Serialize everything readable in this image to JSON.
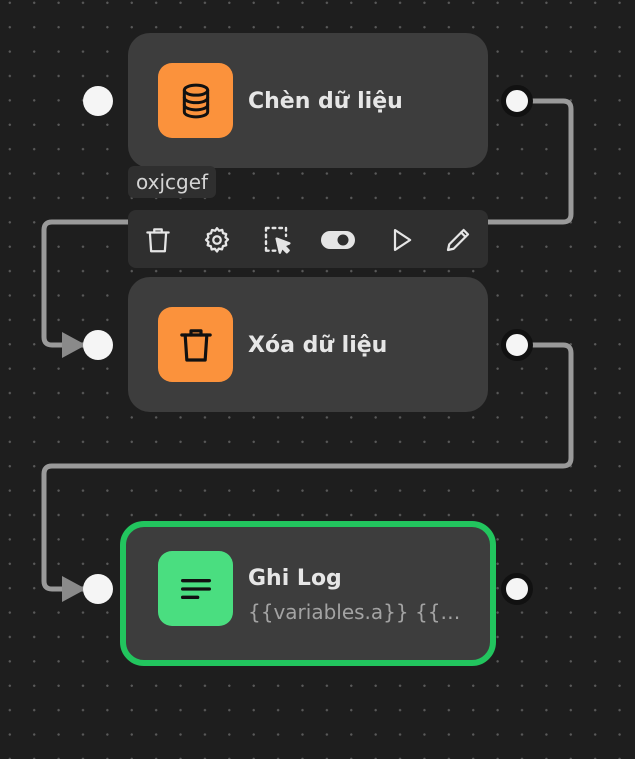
{
  "canvas": {
    "accent_color": "#22c55e",
    "background_color": "#1e1e1e"
  },
  "nodes": [
    {
      "id": "n1",
      "title": "Chèn dữ liệu",
      "icon": "database-icon",
      "icon_color": "#fb923c"
    },
    {
      "id": "n2",
      "title": "Xóa dữ liệu",
      "icon": "trash-icon",
      "icon_color": "#fb923c"
    },
    {
      "id": "n3",
      "title": "Ghi Log",
      "subtitle": "{{variables.a}} {{t…",
      "icon": "text-lines-icon",
      "icon_color": "#4ade80",
      "selected": true
    }
  ],
  "selection": {
    "node_id_label": "oxjcgef"
  },
  "toolbar": {
    "tools": [
      {
        "name": "delete",
        "icon": "trash-icon"
      },
      {
        "name": "settings",
        "icon": "gear-icon"
      },
      {
        "name": "select",
        "icon": "selection-cursor-icon"
      },
      {
        "name": "toggle",
        "icon": "toggle-icon"
      },
      {
        "name": "run",
        "icon": "play-icon"
      },
      {
        "name": "edit",
        "icon": "pencil-icon"
      }
    ]
  }
}
